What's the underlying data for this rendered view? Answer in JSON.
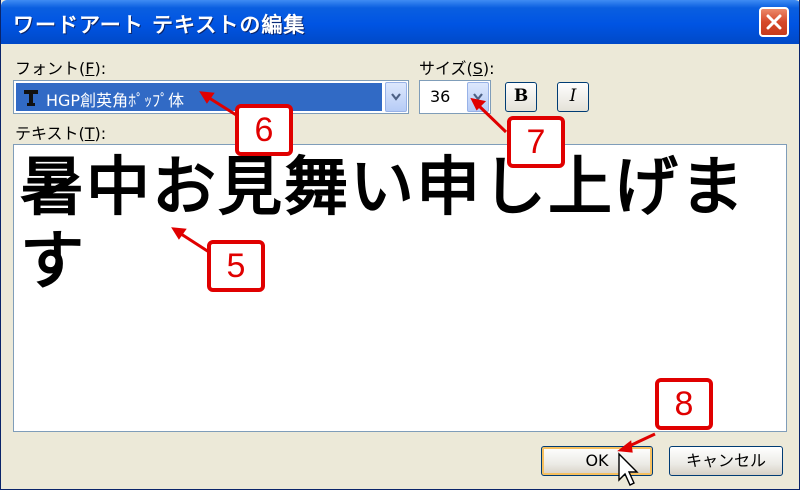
{
  "window": {
    "title": "ワードアート テキストの編集"
  },
  "font": {
    "label": "フォント(",
    "mnemonic": "F",
    "label_end": "):",
    "value": "HGP創英角ﾎﾟｯﾌﾟ体"
  },
  "size": {
    "label": "サイズ(",
    "mnemonic": "S",
    "label_end": "):",
    "value": "36"
  },
  "style_buttons": {
    "bold": "B",
    "italic": "I"
  },
  "text": {
    "label": "テキスト(",
    "mnemonic": "T",
    "label_end": "):",
    "value": "暑中お見舞い申し上げます"
  },
  "buttons": {
    "ok": "OK",
    "cancel": "キャンセル"
  },
  "callouts": {
    "c5": "5",
    "c6": "6",
    "c7": "7",
    "c8": "8"
  },
  "colors": {
    "titlebar": "#0054e3",
    "selection": "#316ac5",
    "callout": "#e00000",
    "dialog_bg": "#ece9d8"
  },
  "icons": [
    "close-icon",
    "truetype-font-icon",
    "chevron-down-icon",
    "mouse-cursor-icon"
  ]
}
